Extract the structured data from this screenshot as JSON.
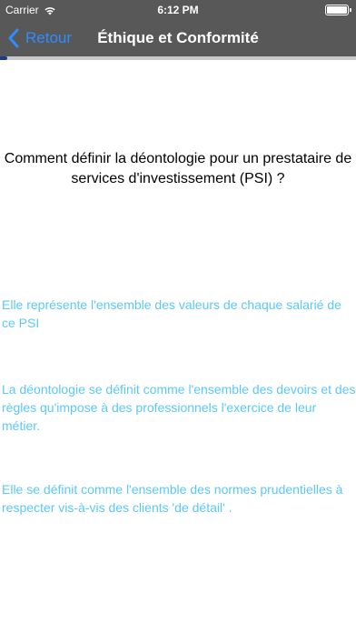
{
  "status_bar": {
    "carrier": "Carrier",
    "time": "6:12 PM",
    "wifi_icon": "wifi-icon",
    "battery_icon": "battery-full-icon",
    "battery_level": 1.0
  },
  "nav": {
    "back_label": "Retour",
    "back_icon": "chevron-left-icon",
    "title": "Éthique et Conformité",
    "accent_color": "#2f8cff",
    "bar_color": "#585858"
  },
  "progress": {
    "value": 0.01,
    "color": "#1f3a8a"
  },
  "quiz": {
    "question": "Comment définir la déontologie pour un prestataire de services d'investissement (PSI) ?",
    "answer_color": "#5ac8fa",
    "answers": [
      {
        "text": "Elle représente l'ensemble des valeurs de chaque salarié de ce PSI"
      },
      {
        "text": "La déontologie se définit comme l'ensemble des devoirs et des règles qu'impose à des professionnels l'exercice de leur métier."
      },
      {
        "text": "Elle se définit comme l'ensemble des normes prudentielles à respecter vis-à-vis des clients 'de détail' ."
      }
    ]
  }
}
